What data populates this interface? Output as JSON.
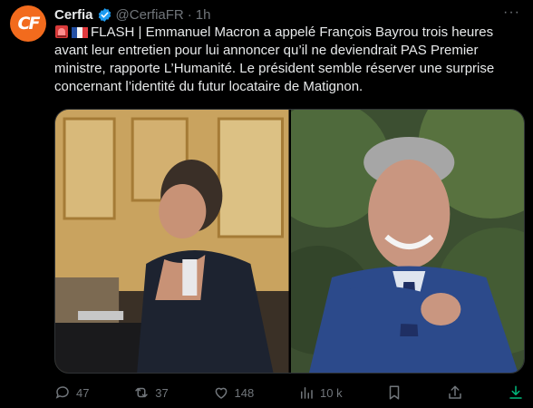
{
  "author": {
    "display_name": "Cerfia",
    "handle": "@CerfiaFR",
    "separator": "·",
    "time": "1h",
    "avatar_text": "CF",
    "verified": true
  },
  "tweet": {
    "flash_label": "FLASH",
    "text": "FLASH | Emmanuel Macron a appelé François Bayrou trois heures avant leur entretien pour lui annoncer qu’il ne deviendrait PAS Premier ministre, rapporte L’Humanité. Le président semble réserver une surprise concernant l’identité du futur locataire de Matignon.",
    "emojis": [
      "rotating-light-icon",
      "france-flag-icon"
    ]
  },
  "actions": {
    "replies": "47",
    "reposts": "37",
    "likes": "148",
    "views": "10 k"
  },
  "colors": {
    "background": "#000000",
    "text": "#e7e9ea",
    "muted": "#71767b",
    "accent": "#1d9bf0",
    "avatar": "#f26b1d"
  }
}
